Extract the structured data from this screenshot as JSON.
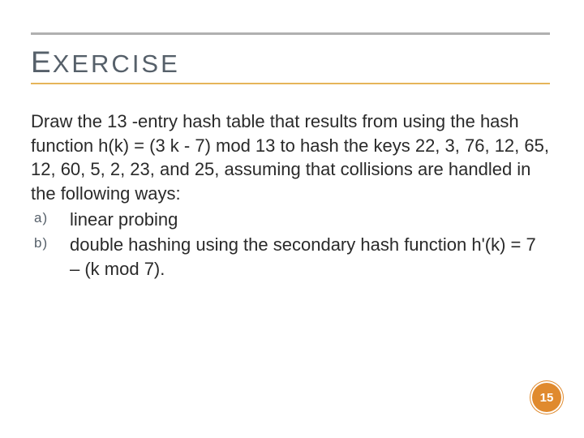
{
  "heading": {
    "lead": "E",
    "rest": "XERCISE"
  },
  "intro": "Draw the 13 -entry hash table that results from using the hash function h(k) = (3 k - 7) mod 13 to hash the keys 22, 3, 76, 12, 65, 12, 60, 5, 2, 23, and 25, assuming that collisions are handled in the following ways:",
  "items": [
    {
      "marker": "a)",
      "text": "linear probing"
    },
    {
      "marker": "b)",
      "text": "double hashing using the secondary hash function h'(k) = 7 – (k mod 7)."
    }
  ],
  "page_number": "15",
  "colors": {
    "accent_orange": "#e08a2e",
    "rule_yellow": "#e6b55a",
    "rule_gray": "#b0b0b0",
    "heading_gray": "#56606a"
  }
}
